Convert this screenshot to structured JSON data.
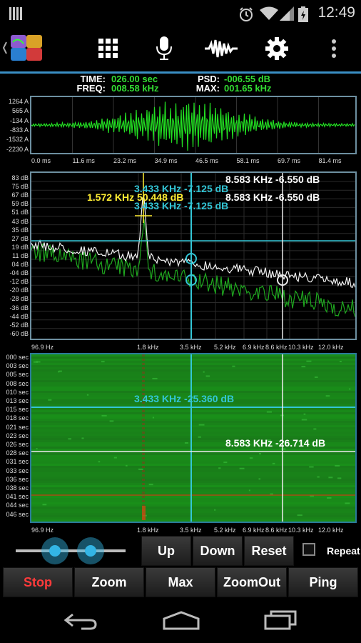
{
  "status": {
    "time": "12:49"
  },
  "readout": {
    "time_label": "TIME:",
    "time_value": "026.00 sec",
    "freq_label": "FREQ:",
    "freq_value": "008.58 kHz",
    "psd_label": "PSD:",
    "psd_value": "-006.55 dB",
    "max_label": "MAX:",
    "max_value": "001.65 kHz"
  },
  "waveform": {
    "y_labels": [
      "1264 A",
      "565 A",
      "-134 A",
      "-833 A",
      "-1532 A",
      "-2230 A"
    ],
    "x_labels": [
      "0.0 ms",
      "11.6 ms",
      "23.2 ms",
      "34.9 ms",
      "46.5 ms",
      "58.1 ms",
      "69.7 ms",
      "81.4 ms"
    ]
  },
  "spectrum": {
    "y_labels": [
      "83 dB",
      "75 dB",
      "67 dB",
      "59 dB",
      "51 dB",
      "43 dB",
      "35 dB",
      "27 dB",
      "19 dB",
      "11 dB",
      "04 dB",
      "-04 dB",
      "-12 dB",
      "-20 dB",
      "-28 dB",
      "-36 dB",
      "-44 dB",
      "-52 dB",
      "-60 dB"
    ],
    "x_labels": [
      "96.9 Hz",
      "1.8 kHz",
      "3.5 kHz",
      "5.2 kHz",
      "6.9 kHz",
      "8.6 kHz",
      "10.3 kHz",
      "12.0 kHz"
    ],
    "cursor_right_1": "8.583 KHz  -6.550 dB",
    "cursor_cyan_1": "3.433 KHz  -7.125 dB",
    "peak_label": "1.572 KHz  50.448 dB",
    "cursor_right_2": "8.583 KHz  -6.550 dB",
    "cursor_cyan_2": "3.433 KHz  -7.125 dB"
  },
  "spectrogram": {
    "y_labels": [
      "000 sec",
      "003 sec",
      "005 sec",
      "008 sec",
      "010 sec",
      "013 sec",
      "015 sec",
      "018 sec",
      "021 sec",
      "023 sec",
      "026 sec",
      "028 sec",
      "031 sec",
      "033 sec",
      "036 sec",
      "038 sec",
      "041 sec",
      "044 sec",
      "046 sec"
    ],
    "x_labels": [
      "96.9 Hz",
      "1.8 kHz",
      "3.5 kHz",
      "5.2 kHz",
      "6.9 kHz",
      "8.6 kHz",
      "10.3 kHz",
      "12.0 kHz"
    ],
    "cursor_cyan": "3.433 KHz  -25.360 dB",
    "cursor_white": "8.583 KHz  -26.714 dB"
  },
  "controls": {
    "up": "Up",
    "down": "Down",
    "reset": "Reset",
    "repeat": "Repeat",
    "stop": "Stop",
    "zoom": "Zoom",
    "max": "Max",
    "zoomout": "ZoomOut",
    "ping": "Ping"
  },
  "colors": {
    "accent": "#3a8fc4",
    "signal": "#22dd22",
    "cyan": "#33c6d6",
    "yellow": "#ffee33",
    "stop": "#ff3b3b"
  }
}
